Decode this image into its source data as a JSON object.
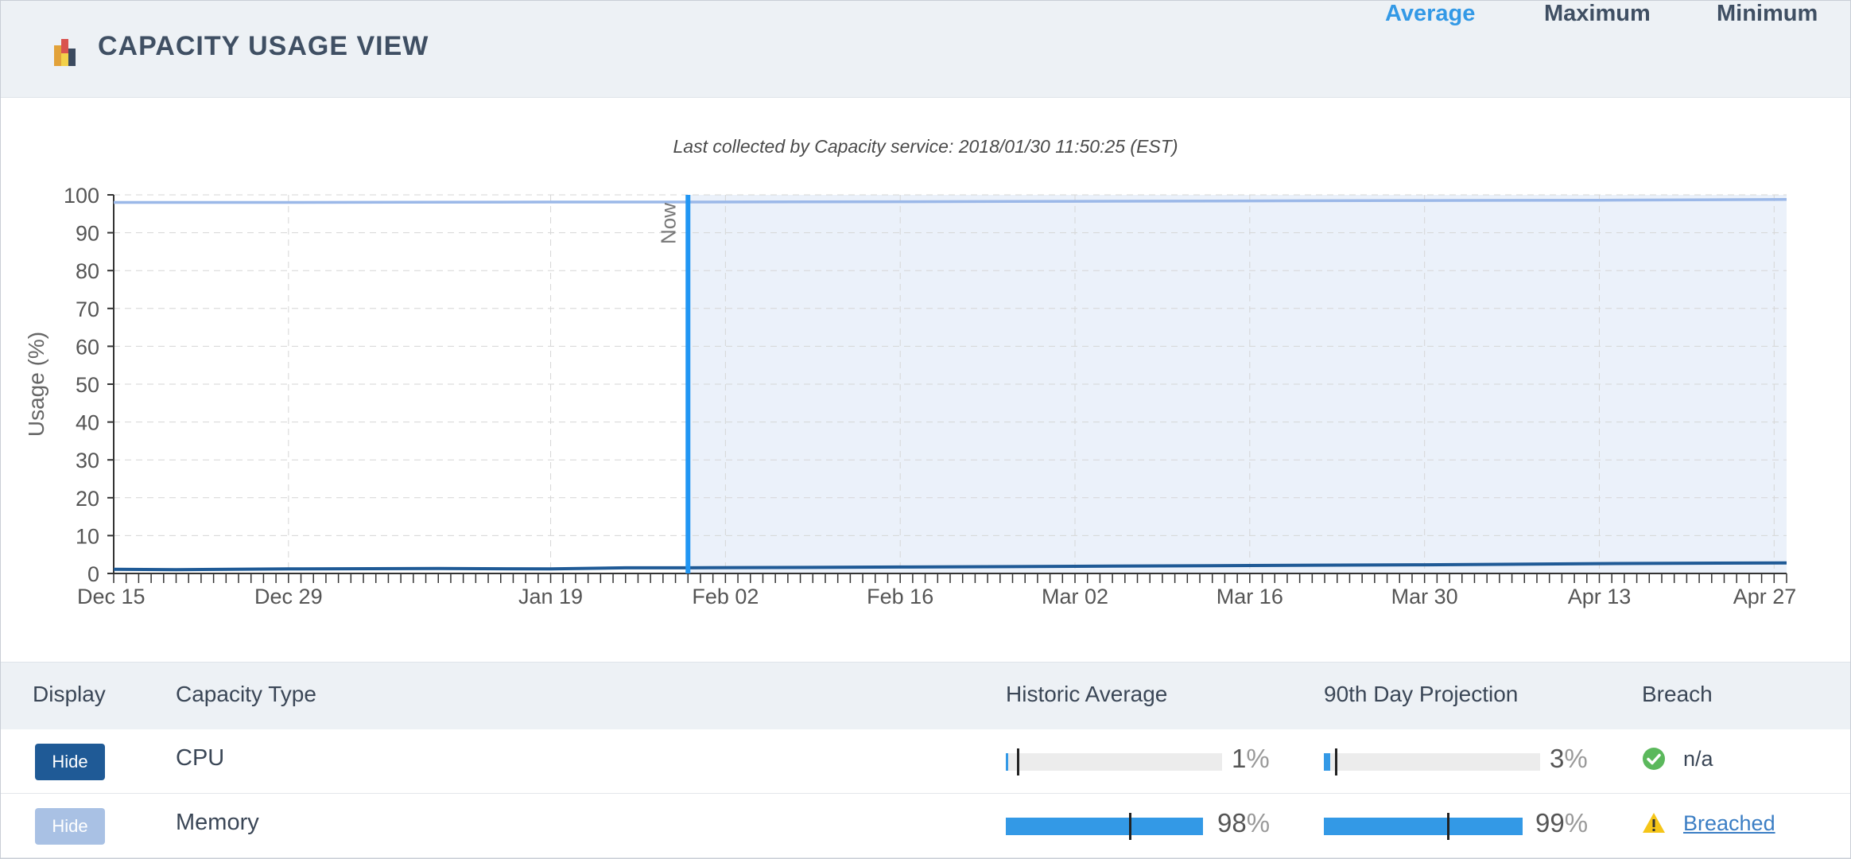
{
  "header": {
    "title": "CAPACITY USAGE VIEW",
    "logo_icon": "capacity-bars-icon",
    "tabs": [
      {
        "label": "Average",
        "active": true
      },
      {
        "label": "Maximum",
        "active": false
      },
      {
        "label": "Minimum",
        "active": false
      }
    ]
  },
  "collected_text": "Last collected by Capacity service: 2018/01/30 11:50:25 (EST)",
  "chart_data": {
    "type": "line",
    "ylabel": "Usage (%)",
    "ylim": [
      0,
      100
    ],
    "yticks": [
      0,
      10,
      20,
      30,
      40,
      50,
      60,
      70,
      80,
      90,
      100
    ],
    "xlim": [
      "2017-12-15",
      "2018-04-28"
    ],
    "xtick_labels": [
      "Dec 15",
      "Dec 29",
      "Jan 19",
      "Feb 02",
      "Feb 16",
      "Mar 02",
      "Mar 16",
      "Mar 30",
      "Apr 13",
      "Apr 27"
    ],
    "xtick_dates": [
      "2017-12-15",
      "2017-12-29",
      "2018-01-19",
      "2018-02-02",
      "2018-02-16",
      "2018-03-02",
      "2018-03-16",
      "2018-03-30",
      "2018-04-13",
      "2018-04-27"
    ],
    "now_label": "Now",
    "now_date": "2018-01-30",
    "projection_shaded": true,
    "grid": true,
    "series": [
      {
        "name": "Memory",
        "color": "#9bb8e8",
        "points": [
          [
            "2017-12-15",
            98.0
          ],
          [
            "2017-12-29",
            98.0
          ],
          [
            "2018-01-19",
            98.1
          ],
          [
            "2018-01-30",
            98.1
          ],
          [
            "2018-02-16",
            98.2
          ],
          [
            "2018-03-02",
            98.3
          ],
          [
            "2018-03-16",
            98.4
          ],
          [
            "2018-03-30",
            98.5
          ],
          [
            "2018-04-13",
            98.6
          ],
          [
            "2018-04-28",
            98.8
          ]
        ]
      },
      {
        "name": "CPU",
        "color": "#1f5a96",
        "points": [
          [
            "2017-12-15",
            1.1
          ],
          [
            "2017-12-20",
            1.0
          ],
          [
            "2017-12-29",
            1.2
          ],
          [
            "2018-01-10",
            1.3
          ],
          [
            "2018-01-19",
            1.2
          ],
          [
            "2018-01-25",
            1.5
          ],
          [
            "2018-01-30",
            1.5
          ],
          [
            "2018-02-16",
            1.7
          ],
          [
            "2018-03-02",
            1.9
          ],
          [
            "2018-03-16",
            2.1
          ],
          [
            "2018-03-30",
            2.3
          ],
          [
            "2018-04-13",
            2.6
          ],
          [
            "2018-04-28",
            2.8
          ]
        ]
      }
    ]
  },
  "table": {
    "headers": {
      "display": "Display",
      "capacity_type": "Capacity Type",
      "historic": "Historic Average",
      "projection": "90th Day Projection",
      "breach": "Breach"
    },
    "percent_symbol": "%",
    "rows": [
      {
        "hide_label": "Hide",
        "button_color": "#1f5a96",
        "type": "CPU",
        "historic_value": "1",
        "historic_fraction": 0.01,
        "projection_value": "3",
        "projection_fraction": 0.03,
        "breach_icon": "check-circle-icon",
        "breach_text": "n/a",
        "breach_link": false
      },
      {
        "hide_label": "Hide",
        "button_color": "#a9c1e4",
        "type": "Memory",
        "historic_value": "98",
        "historic_fraction": 0.98,
        "projection_value": "99",
        "projection_fraction": 0.99,
        "breach_icon": "warning-triangle-icon",
        "breach_text": "Breached",
        "breach_link": true
      }
    ]
  }
}
